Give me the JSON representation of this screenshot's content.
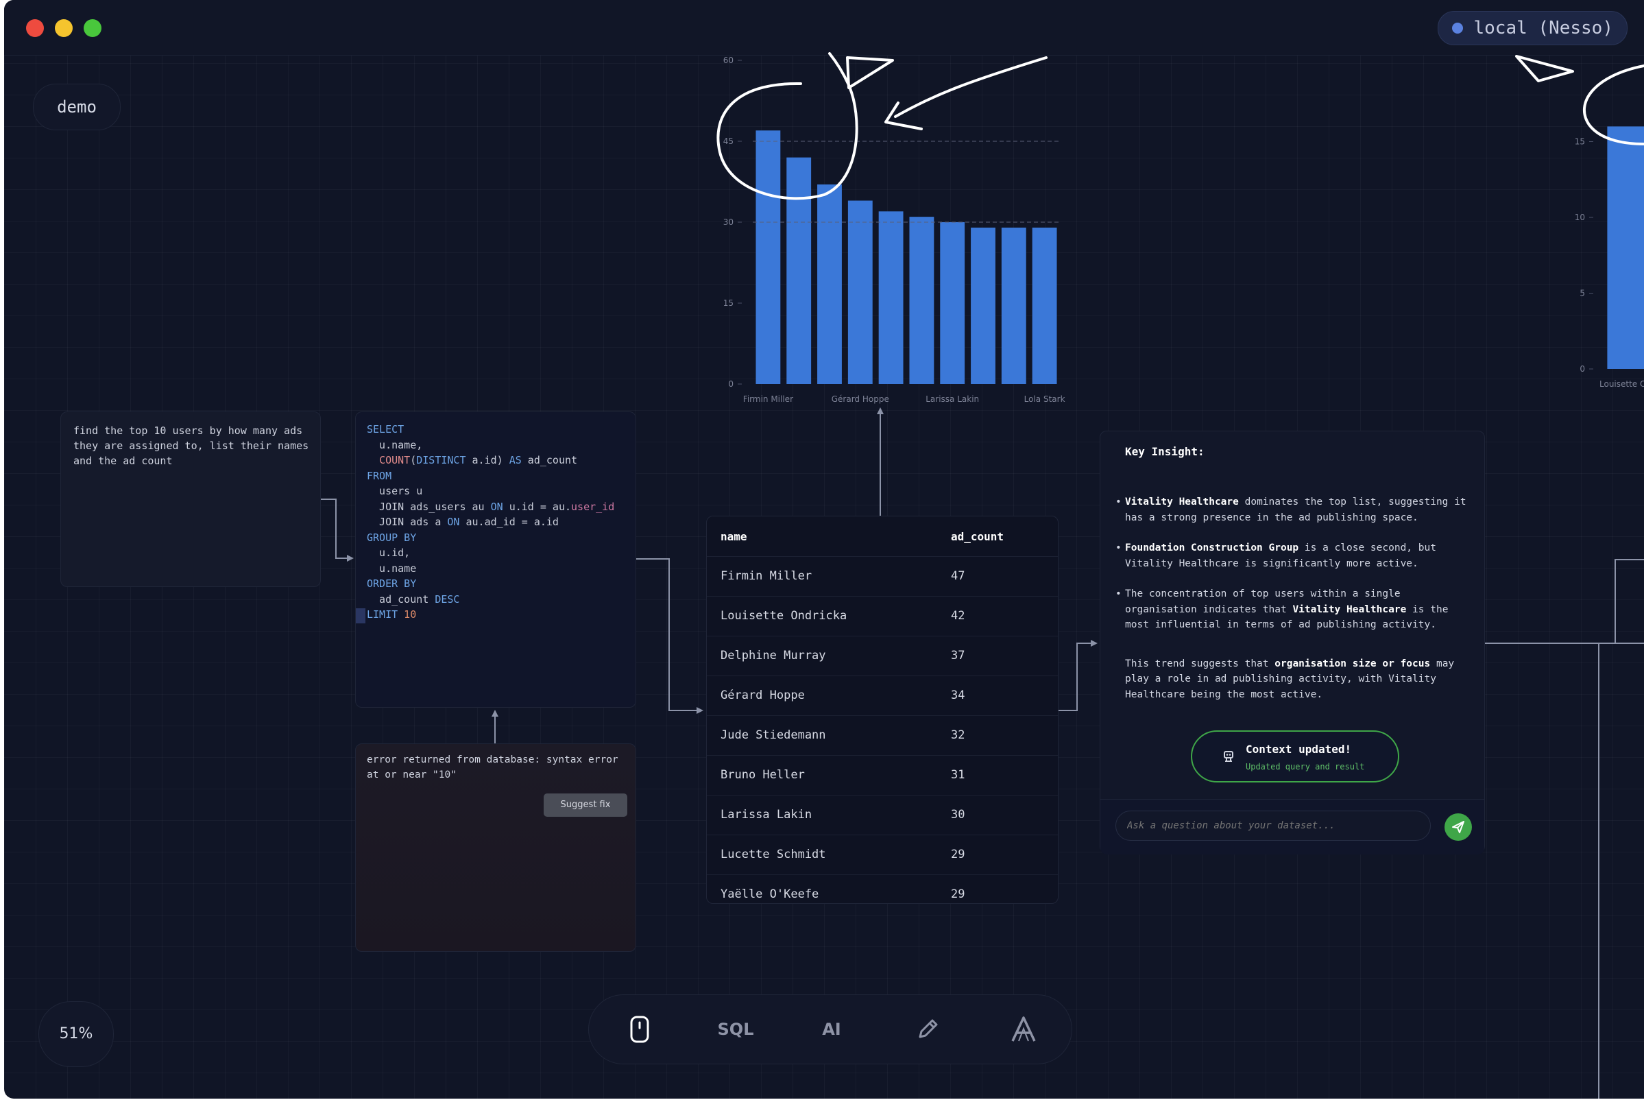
{
  "window": {
    "traffic_lights": {
      "close": "#ee4b3f",
      "minimize": "#f5c42e",
      "maximize": "#49c73c"
    },
    "connection": {
      "label": "local (Nesso)",
      "status_color": "#5b82e0"
    }
  },
  "canvas": {
    "project_name": "demo",
    "zoom": "51%"
  },
  "prompt_node": {
    "text": "find the top 10 users by how many ads\nthey are assigned to, list their names\nand the ad count"
  },
  "sql_node": {
    "lines": [
      {
        "parts": [
          {
            "t": "SELECT",
            "c": "kw"
          }
        ]
      },
      {
        "parts": [
          {
            "t": "  u.name,",
            "c": ""
          }
        ]
      },
      {
        "parts": [
          {
            "t": "  ",
            "c": ""
          },
          {
            "t": "COUNT",
            "c": "fn"
          },
          {
            "t": "(",
            "c": ""
          },
          {
            "t": "DISTINCT",
            "c": "kw"
          },
          {
            "t": " a.id) ",
            "c": ""
          },
          {
            "t": "AS",
            "c": "kw"
          },
          {
            "t": " ad_count",
            "c": ""
          }
        ]
      },
      {
        "parts": [
          {
            "t": "FROM",
            "c": "kw"
          }
        ]
      },
      {
        "parts": [
          {
            "t": "  users u",
            "c": ""
          }
        ]
      },
      {
        "parts": [
          {
            "t": "  JOIN ads_users au ",
            "c": ""
          },
          {
            "t": "ON",
            "c": "kw"
          },
          {
            "t": " u.id = au.",
            "c": ""
          },
          {
            "t": "user_id",
            "c": "col"
          }
        ]
      },
      {
        "parts": [
          {
            "t": "  JOIN ads a ",
            "c": ""
          },
          {
            "t": "ON",
            "c": "kw"
          },
          {
            "t": " au.ad_id = a.id",
            "c": ""
          }
        ]
      },
      {
        "parts": [
          {
            "t": "GROUP BY",
            "c": "kw"
          }
        ]
      },
      {
        "parts": [
          {
            "t": "  u.id,",
            "c": ""
          }
        ]
      },
      {
        "parts": [
          {
            "t": "  u.name",
            "c": ""
          }
        ]
      },
      {
        "parts": [
          {
            "t": "ORDER BY",
            "c": "kw"
          }
        ]
      },
      {
        "parts": [
          {
            "t": "  ad_count ",
            "c": ""
          },
          {
            "t": "DESC",
            "c": "kw"
          }
        ]
      },
      {
        "parts": [
          {
            "t": "LIMIT",
            "c": "kw"
          },
          {
            "t": " 10",
            "c": "num"
          }
        ]
      }
    ]
  },
  "error_node": {
    "message": "error returned from database: syntax error\nat or near \"10\"",
    "suggest_fix_label": "Suggest fix"
  },
  "result_table": {
    "columns": [
      "name",
      "ad_count"
    ],
    "rows": [
      [
        "Firmin Miller",
        "47"
      ],
      [
        "Louisette Ondricka",
        "42"
      ],
      [
        "Delphine Murray",
        "37"
      ],
      [
        "Gérard Hoppe",
        "34"
      ],
      [
        "Jude Stiedemann",
        "32"
      ],
      [
        "Bruno Heller",
        "31"
      ],
      [
        "Larissa Lakin",
        "30"
      ],
      [
        "Lucette Schmidt",
        "29"
      ],
      [
        "Yaëlle O'Keefe",
        "29"
      ]
    ]
  },
  "chart_data": [
    {
      "type": "bar",
      "categories": [
        "Firmin Miller",
        "Louisette Ondricka",
        "Delphine Murray",
        "Gérard Hoppe",
        "Jude Stiedemann",
        "Bruno Heller",
        "Larissa Lakin",
        "Lucette Schmidt",
        "Yaëlle O'Keefe",
        "Lola Stark"
      ],
      "visible_tick_labels": [
        "Firmin Miller",
        "Gérard Hoppe",
        "Larissa Lakin",
        "Lola Stark"
      ],
      "values": [
        47,
        42,
        37,
        34,
        32,
        31,
        30,
        29,
        29,
        29
      ],
      "yticks": [
        0,
        15,
        30,
        45,
        60
      ],
      "ylim": [
        0,
        60
      ],
      "bar_color": "#3b78d8",
      "grid": false
    },
    {
      "type": "bar",
      "categories": [
        "Louisette Ondricka"
      ],
      "visible_tick_labels": [
        "Louisette Ondr"
      ],
      "values": [
        16
      ],
      "yticks": [
        0,
        5,
        10,
        15
      ],
      "ylim": [
        0,
        20
      ],
      "bar_color": "#3b78d8",
      "grid": false
    }
  ],
  "insight_node": {
    "title": "Key Insight:",
    "bullets": [
      [
        {
          "t": "Vitality Healthcare",
          "b": true
        },
        {
          "t": " dominates the top list, suggesting it has a strong presence in the ad publishing space.",
          "b": false
        }
      ],
      [
        {
          "t": "Foundation Construction Group",
          "b": true
        },
        {
          "t": " is a close second, but Vitality Healthcare is significantly more active.",
          "b": false
        }
      ],
      [
        {
          "t": "The concentration of top users within a single organisation indicates that ",
          "b": false
        },
        {
          "t": "Vitality Healthcare",
          "b": true
        },
        {
          "t": " is the most influential in terms of ad publishing activity.",
          "b": false
        }
      ]
    ],
    "summary": [
      {
        "t": "This trend suggests that ",
        "b": false
      },
      {
        "t": "organisation size or focus",
        "b": true
      },
      {
        "t": " may play a role in ad publishing activity, with Vitality Healthcare being the most active.",
        "b": false
      }
    ],
    "toast_title": "Context updated!",
    "toast_sub": "Updated query and result",
    "ask_placeholder": "Ask a question about your dataset...",
    "accent": "#3fa648"
  },
  "toolbar": {
    "sql_label": "SQL",
    "ai_label": "AI"
  }
}
